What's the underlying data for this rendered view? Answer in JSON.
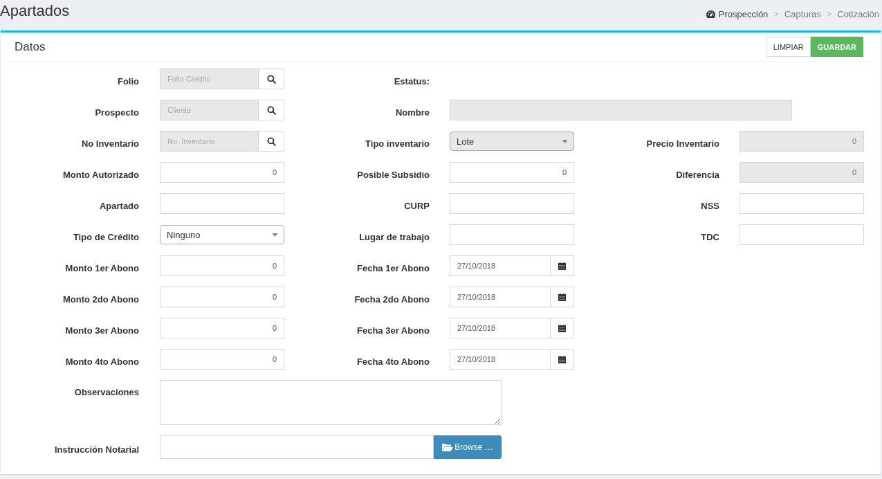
{
  "header": {
    "title": "Apartados",
    "separator": ">",
    "breadcrumb": [
      {
        "label": "Prospección",
        "kind": "home"
      },
      {
        "label": "Capturas",
        "kind": "link"
      },
      {
        "label": "Cotización",
        "kind": "link"
      }
    ]
  },
  "panel": {
    "title": "Datos",
    "buttons": [
      {
        "label": "LIMPIAR",
        "kind": "default"
      },
      {
        "label": "GUARDAR",
        "kind": "primary"
      }
    ]
  },
  "rows": [
    [
      {
        "label": "Folio",
        "kind": "search",
        "placeholder": "Folio Credito",
        "disabled": true
      },
      {
        "label": "Estatus:",
        "kind": "none"
      }
    ],
    [
      {
        "label": "Prospecto",
        "kind": "search",
        "placeholder": "Cliente",
        "disabled": true
      },
      {
        "label": "Nombre",
        "kind": "long",
        "disabled": true
      }
    ],
    [
      {
        "label": "No Inventario",
        "kind": "search",
        "placeholder": "No. Inventario",
        "disabled": true
      },
      {
        "label": "Tipo inventario",
        "kind": "select",
        "value": "Lote",
        "disabled": true
      },
      {
        "label": "Precio Inventario",
        "kind": "number",
        "value": "0",
        "disabled": true
      }
    ],
    [
      {
        "label": "Monto Autorizado",
        "kind": "number",
        "value": "0",
        "disabled": false
      },
      {
        "label": "Posible Subsidio",
        "kind": "number",
        "value": "0",
        "disabled": false
      },
      {
        "label": "Diferencia",
        "kind": "number",
        "value": "0",
        "disabled": true
      }
    ],
    [
      {
        "label": "Apartado",
        "kind": "text",
        "disabled": false
      },
      {
        "label": "CURP",
        "kind": "text",
        "disabled": false
      },
      {
        "label": "NSS",
        "kind": "text",
        "disabled": false
      }
    ],
    [
      {
        "label": "Tipo de Crédito",
        "kind": "select",
        "value": "Ninguno",
        "disabled": false
      },
      {
        "label": "Lugar de trabajo",
        "kind": "text",
        "disabled": false
      },
      {
        "label": "TDC",
        "kind": "text",
        "disabled": false
      }
    ],
    [
      {
        "label": "Monto 1er Abono",
        "kind": "number",
        "value": "0",
        "disabled": false
      },
      {
        "label": "Fecha 1er Abono",
        "kind": "date",
        "value": "27/10/2018",
        "disabled": false
      }
    ],
    [
      {
        "label": "Monto 2do Abono",
        "kind": "number",
        "value": "0",
        "disabled": false
      },
      {
        "label": "Fecha 2do Abono",
        "kind": "date",
        "value": "27/10/2018",
        "disabled": false
      }
    ],
    [
      {
        "label": "Monto 3er Abono",
        "kind": "number",
        "value": "0",
        "disabled": false
      },
      {
        "label": "Fecha 3er Abono",
        "kind": "date",
        "value": "27/10/2018",
        "disabled": false
      }
    ],
    [
      {
        "label": "Monto 4to Abono",
        "kind": "number",
        "value": "0",
        "disabled": false
      },
      {
        "label": "Fecha 4to Abono",
        "kind": "date",
        "value": "27/10/2018",
        "disabled": false
      }
    ],
    [
      {
        "label": "Observaciones",
        "kind": "textarea",
        "disabled": false
      }
    ],
    [
      {
        "label": "Instrucción Notarial",
        "kind": "file",
        "button": "Browse …",
        "disabled": false
      }
    ]
  ]
}
